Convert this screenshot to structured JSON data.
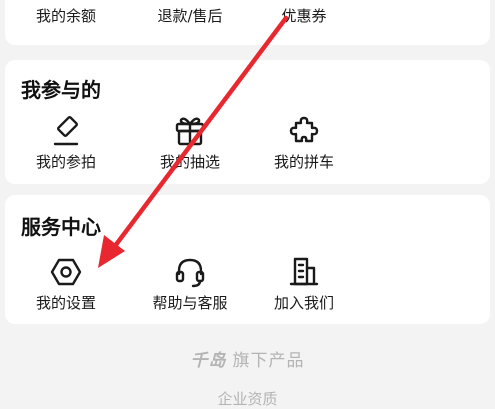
{
  "top_row": {
    "items": [
      {
        "label": "我的余额"
      },
      {
        "label": "退款/售后"
      },
      {
        "label": "优惠券"
      }
    ]
  },
  "participate": {
    "title": "我参与的",
    "items": [
      {
        "label": "我的参拍",
        "icon": "auction-hammer-icon"
      },
      {
        "label": "我的抽选",
        "icon": "gift-icon"
      },
      {
        "label": "我的拼车",
        "icon": "puzzle-icon"
      }
    ]
  },
  "service": {
    "title": "服务中心",
    "items": [
      {
        "label": "我的设置",
        "icon": "settings-hex-icon"
      },
      {
        "label": "帮助与客服",
        "icon": "headset-icon"
      },
      {
        "label": "加入我们",
        "icon": "building-icon"
      }
    ]
  },
  "footer": {
    "brand_logo": "千岛",
    "brand_text": "旗下产品",
    "qualification": "企业资质"
  },
  "colors": {
    "annotation_arrow": "#e8272f",
    "background": "#f3f3f3"
  }
}
